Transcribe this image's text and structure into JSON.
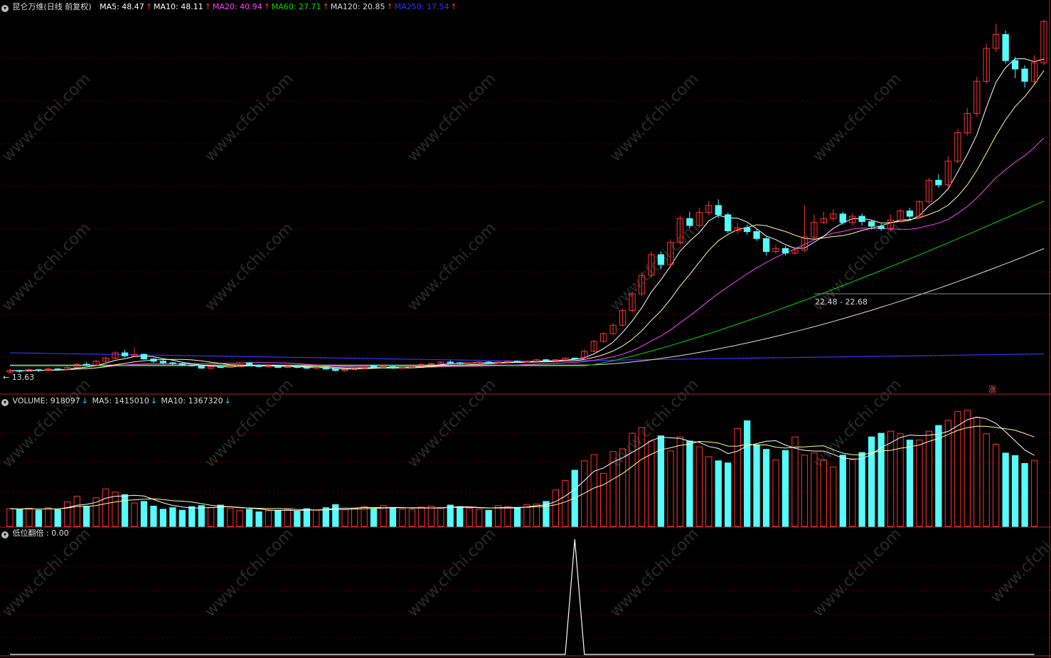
{
  "main_legend": {
    "title": "昆仑万维(日线 前复权)",
    "ma": [
      {
        "label": "MA5: 48.47",
        "arrow": "↑",
        "color": "#ffffff"
      },
      {
        "label": "MA10: 48.11",
        "arrow": "↑",
        "color": "#ffffff"
      },
      {
        "label": "MA20: 40.94",
        "arrow": "↑",
        "color": "#ff44ff"
      },
      {
        "label": "MA60: 27.71",
        "arrow": "↑",
        "color": "#00dd00"
      },
      {
        "label": "MA120: 20.85",
        "arrow": "↑",
        "color": "#dddddd"
      },
      {
        "label": "MA250: 17.54",
        "arrow": "↑",
        "color": "#3333ff"
      }
    ]
  },
  "volume_legend": {
    "items": [
      {
        "label": "VOLUME: 918097",
        "arrow": "↓"
      },
      {
        "label": "MA5: 1415010",
        "arrow": "↓"
      },
      {
        "label": "MA10: 1367320",
        "arrow": "↓"
      }
    ]
  },
  "indicator_legend": {
    "label": "低位翻倍 : 0.00"
  },
  "annotations": {
    "low_price": "13.63",
    "range": "22.48 - 22.68",
    "zhang": "涨"
  },
  "colors": {
    "up": "#ff3232",
    "down": "#54fcfc",
    "ma5": "#ffffff",
    "ma10": "#ffff99",
    "ma20": "#ff44ff",
    "ma60": "#00dd00",
    "ma120": "#dddddd",
    "ma250": "#3333ff",
    "grid": "#5a0000",
    "border": "#b41e1e"
  },
  "watermark": "www.cfchi.com",
  "chart_data": {
    "type": "candlestick",
    "series": [
      {
        "name": "VOLUME"
      },
      {
        "name": "MA5"
      },
      {
        "name": "MA10"
      },
      {
        "name": "低位翻倍"
      }
    ],
    "price_range": [
      13.63,
      60
    ],
    "candles": [
      [
        14.1,
        14.3,
        14.5,
        13.9
      ],
      [
        14.3,
        14.2,
        14.4,
        14.0
      ],
      [
        14.2,
        14.4,
        14.6,
        14.1
      ],
      [
        14.4,
        14.3,
        14.5,
        14.1
      ],
      [
        14.3,
        14.5,
        14.7,
        14.2
      ],
      [
        14.5,
        14.4,
        14.6,
        14.3
      ],
      [
        14.4,
        14.7,
        14.9,
        14.3
      ],
      [
        14.7,
        15.1,
        15.3,
        14.6
      ],
      [
        15.1,
        15.0,
        15.4,
        14.9
      ],
      [
        15.0,
        15.5,
        15.7,
        14.9
      ],
      [
        15.5,
        15.9,
        16.1,
        15.3
      ],
      [
        15.9,
        16.6,
        16.8,
        15.8
      ],
      [
        16.6,
        16.2,
        17.0,
        16.0
      ],
      [
        16.2,
        16.4,
        17.3,
        16.1
      ],
      [
        16.4,
        15.8,
        16.5,
        15.7
      ],
      [
        15.8,
        15.5,
        15.9,
        15.3
      ],
      [
        15.5,
        15.3,
        15.7,
        15.1
      ],
      [
        15.3,
        15.2,
        15.4,
        15.0
      ],
      [
        15.2,
        15.0,
        15.3,
        14.9
      ],
      [
        15.0,
        14.9,
        15.1,
        14.8
      ],
      [
        14.9,
        14.6,
        15.0,
        14.5
      ],
      [
        14.6,
        14.8,
        14.9,
        14.5
      ],
      [
        14.8,
        14.7,
        14.9,
        14.6
      ],
      [
        14.7,
        14.8,
        14.9,
        14.6
      ],
      [
        14.8,
        15.3,
        15.4,
        14.7
      ],
      [
        15.3,
        15.0,
        15.4,
        14.9
      ],
      [
        15.0,
        14.8,
        15.1,
        14.7
      ],
      [
        14.8,
        14.9,
        15.0,
        14.7
      ],
      [
        14.9,
        14.7,
        15.0,
        14.6
      ],
      [
        14.7,
        14.8,
        14.9,
        14.6
      ],
      [
        14.8,
        14.7,
        14.9,
        14.6
      ],
      [
        14.7,
        14.6,
        14.8,
        14.5
      ],
      [
        14.6,
        14.7,
        14.8,
        14.5
      ],
      [
        14.7,
        14.5,
        14.8,
        14.4
      ],
      [
        14.5,
        14.3,
        14.6,
        14.2
      ],
      [
        14.3,
        14.4,
        14.5,
        14.2
      ],
      [
        14.4,
        14.6,
        14.7,
        14.3
      ],
      [
        14.6,
        14.9,
        15.0,
        14.5
      ],
      [
        14.9,
        14.7,
        15.0,
        14.6
      ],
      [
        14.7,
        14.8,
        14.9,
        14.6
      ],
      [
        14.8,
        14.6,
        14.9,
        14.5
      ],
      [
        14.6,
        14.7,
        14.8,
        14.5
      ],
      [
        14.7,
        14.9,
        15.0,
        14.6
      ],
      [
        14.9,
        15.1,
        15.2,
        14.8
      ],
      [
        15.1,
        15.2,
        15.3,
        15.0
      ],
      [
        15.2,
        15.4,
        15.5,
        15.1
      ],
      [
        15.4,
        15.3,
        15.6,
        15.2
      ],
      [
        15.3,
        15.2,
        15.4,
        15.1
      ],
      [
        15.2,
        15.3,
        15.4,
        15.1
      ],
      [
        15.3,
        15.4,
        15.5,
        15.2
      ],
      [
        15.4,
        15.3,
        15.5,
        15.2
      ],
      [
        15.3,
        15.4,
        15.5,
        15.2
      ],
      [
        15.4,
        15.5,
        15.6,
        15.3
      ],
      [
        15.5,
        15.4,
        15.6,
        15.3
      ],
      [
        15.4,
        15.5,
        15.6,
        15.3
      ],
      [
        15.5,
        15.7,
        15.8,
        15.4
      ],
      [
        15.7,
        15.6,
        15.8,
        15.5
      ],
      [
        15.6,
        15.7,
        15.8,
        15.5
      ],
      [
        15.7,
        15.9,
        16.0,
        15.6
      ],
      [
        15.9,
        15.8,
        16.0,
        15.7
      ],
      [
        15.8,
        16.8,
        17.0,
        15.7
      ],
      [
        16.8,
        18.1,
        18.3,
        16.7
      ],
      [
        18.1,
        19.1,
        19.3,
        17.9
      ],
      [
        19.1,
        20.2,
        20.5,
        18.9
      ],
      [
        20.2,
        22.1,
        22.4,
        20.0
      ],
      [
        22.1,
        24.3,
        24.6,
        21.9
      ],
      [
        24.3,
        26.7,
        27.1,
        24.0
      ],
      [
        26.7,
        29.4,
        29.8,
        26.4
      ],
      [
        29.4,
        28.1,
        29.8,
        27.5
      ],
      [
        28.1,
        31.0,
        31.4,
        27.9
      ],
      [
        31.0,
        34.1,
        34.5,
        30.7
      ],
      [
        34.1,
        33.2,
        35.0,
        32.8
      ],
      [
        33.2,
        34.9,
        35.5,
        32.9
      ],
      [
        34.9,
        35.8,
        36.4,
        34.5
      ],
      [
        35.8,
        34.6,
        36.6,
        34.2
      ],
      [
        34.6,
        32.5,
        34.9,
        32.2
      ],
      [
        32.5,
        32.9,
        33.6,
        32.1
      ],
      [
        32.9,
        32.4,
        33.3,
        32.0
      ],
      [
        32.4,
        31.5,
        32.8,
        31.2
      ],
      [
        31.5,
        29.8,
        31.7,
        29.3
      ],
      [
        29.8,
        30.2,
        30.7,
        29.5
      ],
      [
        30.2,
        29.6,
        30.5,
        29.3
      ],
      [
        29.6,
        30.0,
        30.4,
        29.4
      ],
      [
        30.0,
        31.7,
        35.8,
        29.7
      ],
      [
        31.7,
        33.6,
        34.6,
        31.4
      ],
      [
        33.6,
        34.1,
        35.0,
        33.4
      ],
      [
        34.1,
        34.7,
        35.3,
        33.8
      ],
      [
        34.7,
        33.6,
        35.0,
        33.3
      ],
      [
        33.6,
        34.4,
        34.8,
        33.2
      ],
      [
        34.4,
        33.7,
        34.8,
        33.2
      ],
      [
        33.7,
        33.1,
        33.9,
        32.7
      ],
      [
        33.1,
        32.8,
        33.4,
        32.5
      ],
      [
        32.8,
        33.9,
        34.6,
        32.4
      ],
      [
        33.9,
        35.1,
        35.4,
        33.6
      ],
      [
        35.1,
        34.4,
        35.5,
        34.0
      ],
      [
        34.4,
        36.3,
        36.5,
        34.1
      ],
      [
        36.3,
        39.1,
        39.4,
        36.0
      ],
      [
        39.1,
        38.5,
        39.9,
        38.1
      ],
      [
        38.5,
        41.6,
        42.2,
        38.2
      ],
      [
        41.6,
        45.3,
        45.8,
        41.3
      ],
      [
        45.3,
        47.8,
        48.5,
        44.9
      ],
      [
        47.8,
        52.0,
        52.6,
        47.4
      ],
      [
        52.0,
        56.3,
        56.9,
        51.7
      ],
      [
        56.3,
        58.1,
        59.5,
        55.8
      ],
      [
        58.1,
        54.7,
        58.6,
        54.3
      ],
      [
        54.7,
        53.6,
        55.2,
        52.4
      ],
      [
        53.6,
        52.0,
        54.1,
        51.2
      ],
      [
        52.0,
        54.4,
        55.4,
        51.7
      ],
      [
        54.4,
        59.8,
        60.0,
        54.1
      ]
    ],
    "volumes": [
      0.34,
      0.33,
      0.35,
      0.31,
      0.36,
      0.32,
      0.47,
      0.58,
      0.39,
      0.55,
      0.72,
      0.66,
      0.61,
      0.45,
      0.48,
      0.39,
      0.33,
      0.36,
      0.31,
      0.38,
      0.4,
      0.36,
      0.41,
      0.35,
      0.31,
      0.33,
      0.28,
      0.3,
      0.31,
      0.33,
      0.29,
      0.34,
      0.31,
      0.36,
      0.42,
      0.32,
      0.35,
      0.38,
      0.34,
      0.4,
      0.36,
      0.33,
      0.32,
      0.37,
      0.39,
      0.35,
      0.41,
      0.38,
      0.35,
      0.33,
      0.31,
      0.4,
      0.38,
      0.36,
      0.42,
      0.43,
      0.48,
      0.7,
      0.88,
      1.08,
      1.26,
      1.38,
      1.02,
      1.44,
      1.49,
      1.79,
      1.9,
      1.64,
      1.74,
      1.45,
      1.72,
      1.64,
      1.53,
      1.34,
      1.26,
      1.22,
      1.88,
      2.03,
      1.57,
      1.48,
      1.28,
      1.46,
      1.72,
      1.37,
      1.41,
      1.28,
      1.14,
      1.37,
      1.28,
      1.42,
      1.72,
      1.79,
      1.83,
      1.78,
      1.66,
      1.66,
      1.83,
      1.94,
      2.04,
      2.21,
      2.23,
      2.09,
      1.78,
      1.58,
      1.41,
      1.36,
      1.21,
      1.27
    ],
    "indicator": [
      0,
      0,
      0,
      0,
      0,
      0,
      0,
      0,
      0,
      0,
      0,
      0,
      0,
      0,
      0,
      0,
      0,
      0,
      0,
      0,
      0,
      0,
      0,
      0,
      0,
      0,
      0,
      0,
      0,
      0,
      0,
      0,
      0,
      0,
      0,
      0,
      0,
      0,
      0,
      0,
      0,
      0,
      0,
      0,
      0,
      0,
      0,
      0,
      0,
      0,
      0,
      0,
      0,
      0,
      0,
      0,
      0,
      0,
      0,
      1,
      0,
      0,
      0,
      0,
      0,
      0,
      0,
      0,
      0,
      0,
      0,
      0,
      0,
      0,
      0,
      0,
      0,
      0,
      0,
      0,
      0,
      0,
      0,
      0,
      0,
      0,
      0,
      0,
      0,
      0,
      0,
      0,
      0,
      0,
      0,
      0,
      0,
      0,
      0,
      0,
      0,
      0,
      0,
      0,
      0,
      0,
      0,
      0
    ],
    "indicator_value": 0.0
  }
}
